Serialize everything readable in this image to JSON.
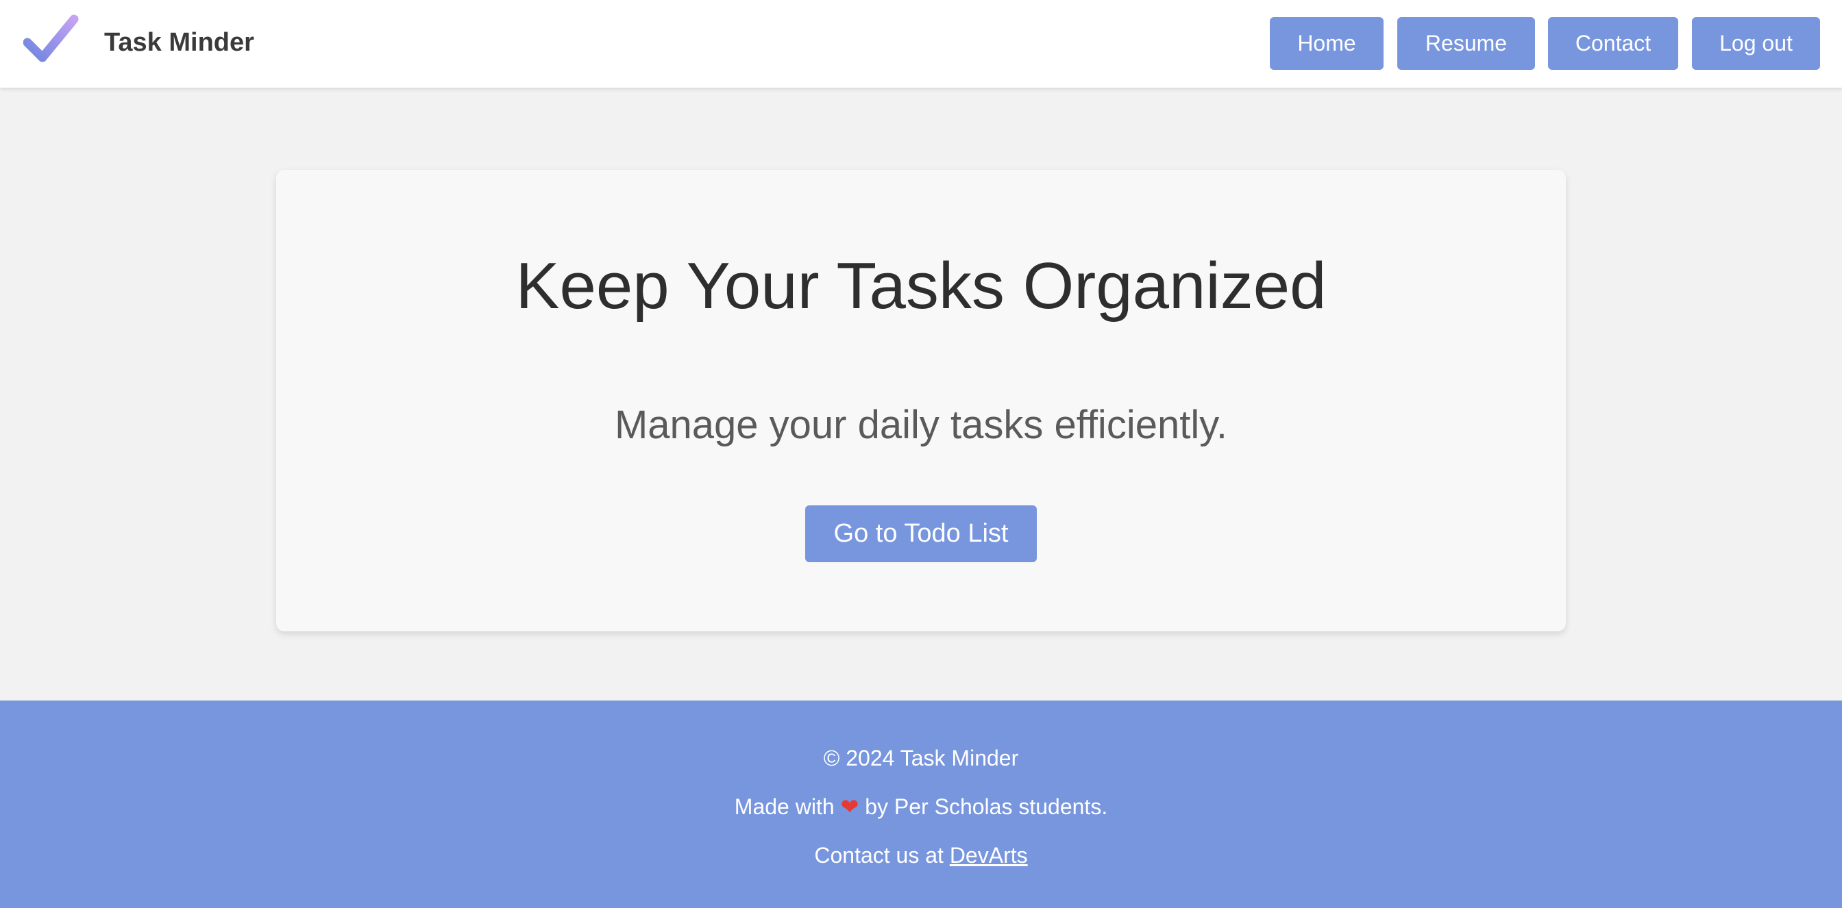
{
  "header": {
    "brand": "Task Minder",
    "logo_icon": "checkmark-icon",
    "nav": {
      "home": "Home",
      "resume": "Resume",
      "contact": "Contact",
      "logout": "Log out"
    }
  },
  "hero": {
    "title": "Keep Your Tasks Organized",
    "subtitle": "Manage your daily tasks efficiently.",
    "cta_label": "Go to Todo List"
  },
  "footer": {
    "copyright": "© 2024 Task Minder",
    "made_with_prefix": "Made with",
    "heart": "❤",
    "made_with_suffix": "by Per Scholas students.",
    "contact_prefix": "Contact us at",
    "contact_link": "DevArts"
  },
  "colors": {
    "accent": "#7896de",
    "background": "#f2f2f2",
    "card": "#f8f8f8",
    "header_bg": "#ffffff"
  }
}
